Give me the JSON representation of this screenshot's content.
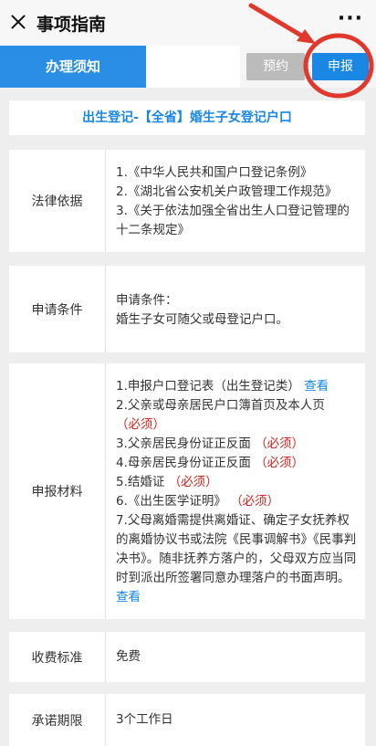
{
  "header": {
    "title": "事项指南",
    "more_label": "···"
  },
  "tabs": {
    "active_label": "办理须知"
  },
  "buttons": {
    "appointment": "预约",
    "apply": "申报"
  },
  "colors": {
    "primary": "#1a87e4",
    "required": "#d1231e",
    "annotation": "#e0382c"
  },
  "service_title": "出生登记-【全省】婚生子女登记户口",
  "legal_basis": {
    "label": "法律依据",
    "items": [
      "1.《中华人民共和国户口登记条例》",
      "2.《湖北省公安机关户政管理工作规范》",
      "3.《关于依法加强全省出生人口登记管理的十二条规定》"
    ]
  },
  "conditions": {
    "label": "申请条件",
    "line1": "申请条件：",
    "line2": "婚生子女可随父或母登记户口。"
  },
  "materials": {
    "label": "申报材料",
    "m1": "1.申报户口登记表（出生登记类）",
    "m1_link": "查看",
    "m2": "2.父亲或母亲居民户口簿首页及本人页",
    "m3": "3.父亲居民身份证正反面",
    "m4": "4.母亲居民身份证正反面",
    "m5": "5.结婚证",
    "m6": "6.《出生医学证明》",
    "m7": "7.父母离婚需提供离婚证、确定子女抚养权的离婚协议书或法院《民事调解书》《民事判决书》。随非抚养方落户的，父母双方应当同时到派出所签署同意办理落户的书面声明。",
    "m7_link": "查看",
    "required": "（必须）"
  },
  "fee": {
    "label": "收费标准",
    "value": "免费"
  },
  "deadline": {
    "label": "承诺期限",
    "value": "3个工作日"
  }
}
